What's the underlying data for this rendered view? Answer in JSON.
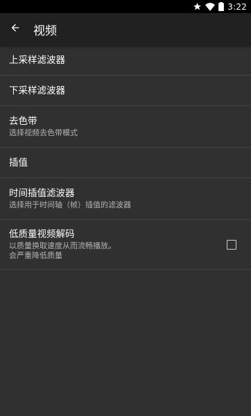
{
  "status_bar": {
    "time": "3:22",
    "icons": [
      "star-icon",
      "wifi-icon",
      "battery-icon"
    ]
  },
  "toolbar": {
    "back_icon": "arrow-back-icon",
    "title": "视频"
  },
  "preferences": [
    {
      "title": "上采样滤波器",
      "summary": ""
    },
    {
      "title": "下采样滤波器",
      "summary": ""
    },
    {
      "title": "去色带",
      "summary": "选择视频去色带模式"
    },
    {
      "title": "插值",
      "summary": ""
    },
    {
      "title": "时间插值滤波器",
      "summary": "选择用于时间轴（帧）插值的滤波器"
    },
    {
      "title": "低质量视频解码",
      "summary_line1": "以质量换取速度从而流畅播放。",
      "summary_line2": "会严重降低质量",
      "checked": false
    }
  ],
  "colors": {
    "background": "#303030",
    "toolbar": "#212121",
    "status_bar": "#000000",
    "divider": "#444444",
    "secondary_text": "#b3b3b3"
  }
}
